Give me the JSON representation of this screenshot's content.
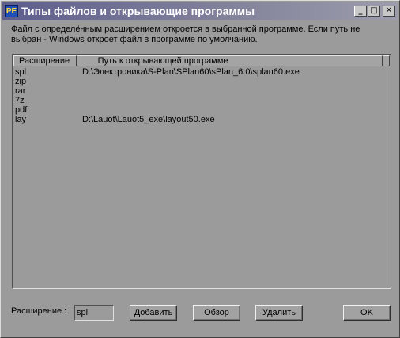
{
  "window": {
    "title": "Типы файлов и открывающие программы",
    "icon_text": "PE",
    "buttons": {
      "minimize": "_",
      "maximize": "□",
      "close": "✕"
    }
  },
  "description": "Файл с определённым расширением откроется в выбранной программе. Если путь не выбран - Windows откроет файл в программе по умолчанию.",
  "list": {
    "columns": {
      "extension": "Расширение",
      "path": "Путь к открывающей программе"
    },
    "rows": [
      {
        "ext": "spl",
        "path": "D:\\Электроника\\S-Plan\\SPlan60\\sPlan_6.0\\splan60.exe"
      },
      {
        "ext": "zip",
        "path": ""
      },
      {
        "ext": "rar",
        "path": ""
      },
      {
        "ext": "7z",
        "path": ""
      },
      {
        "ext": "pdf",
        "path": ""
      },
      {
        "ext": "lay",
        "path": "D:\\Lauot\\Lauot5_exe\\layout50.exe"
      }
    ]
  },
  "form": {
    "extension_label": "Расширение :",
    "extension_value": "spl"
  },
  "actions": {
    "add": "Добавить",
    "browse": "Обзор",
    "delete": "Удалить",
    "ok": "OK"
  }
}
